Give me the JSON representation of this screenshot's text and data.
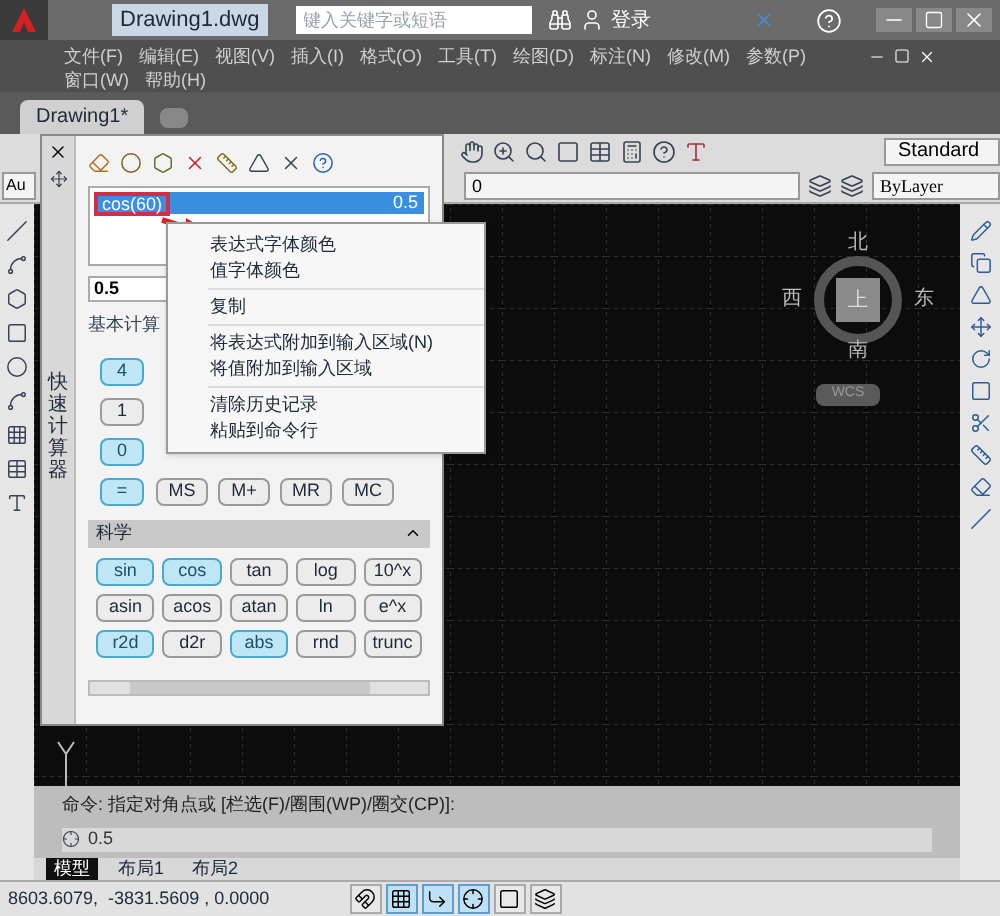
{
  "title_bar": {
    "title": "Drawing1.dwg",
    "search": {
      "placeholder": "键入关键字或短语"
    },
    "login": "登录"
  },
  "menu_rows": [
    [
      "文件(F)",
      "编辑(E)",
      "视图(V)",
      "插入(I)",
      "格式(O)",
      "工具(T)",
      "绘图(D)",
      "标注(N)",
      "修改(M)",
      "参数(P)"
    ],
    [
      "窗口(W)",
      "帮助(H)"
    ]
  ],
  "document_tabs": [
    {
      "label": "Drawing1*",
      "selected": true
    }
  ],
  "toolbar": {
    "left_dropdown": "Au",
    "text_style": "Standard",
    "layer": "0",
    "color_control": "ByLayer"
  },
  "calculator": {
    "title": "快速计算器",
    "history": [
      {
        "expression": "cos(60)",
        "value": "0.5",
        "selected": true
      }
    ],
    "input": "0.5",
    "basic": {
      "title": "基本计算",
      "keys": [
        {
          "label": "4",
          "highlighted": true
        },
        {
          "label": "1",
          "highlighted": false
        },
        {
          "label": "0",
          "highlighted": true
        },
        {
          "label": "=",
          "highlighted": true
        }
      ],
      "memory_keys": [
        {
          "label": "MS",
          "highlighted": false
        },
        {
          "label": "M+",
          "highlighted": false
        },
        {
          "label": "MR",
          "highlighted": false
        },
        {
          "label": "MC",
          "highlighted": false
        }
      ]
    },
    "scientific": {
      "title": "科学",
      "expanded": true,
      "keys": [
        {
          "label": "sin",
          "highlighted": true
        },
        {
          "label": "cos",
          "highlighted": true
        },
        {
          "label": "tan",
          "highlighted": false
        },
        {
          "label": "log",
          "highlighted": false
        },
        {
          "label": "10^x",
          "highlighted": false
        },
        {
          "label": "asin",
          "highlighted": false
        },
        {
          "label": "acos",
          "highlighted": false
        },
        {
          "label": "atan",
          "highlighted": false
        },
        {
          "label": "ln",
          "highlighted": false
        },
        {
          "label": "e^x",
          "highlighted": false
        },
        {
          "label": "r2d",
          "highlighted": true
        },
        {
          "label": "d2r",
          "highlighted": false
        },
        {
          "label": "abs",
          "highlighted": true
        },
        {
          "label": "rnd",
          "highlighted": false
        },
        {
          "label": "trunc",
          "highlighted": false
        }
      ]
    }
  },
  "context_menu": {
    "groups": [
      [
        "表达式字体颜色",
        "值字体颜色"
      ],
      [
        "复制"
      ],
      [
        "将表达式附加到输入区域(N)",
        "将值附加到输入区域"
      ],
      [
        "清除历史记录",
        "粘贴到命令行"
      ]
    ]
  },
  "viewcube": {
    "north": "北",
    "west": "西",
    "east": "东",
    "south": "南",
    "top": "上",
    "wcs": "WCS"
  },
  "command_line": {
    "history": "命令:  指定对角点或 [栏选(F)/圈围(WP)/圈交(CP)]:",
    "input": "0.5"
  },
  "layout_tabs": [
    {
      "label": "模型",
      "selected": true
    },
    {
      "label": "布局1",
      "selected": false
    },
    {
      "label": "布局2",
      "selected": false
    }
  ],
  "status_bar": {
    "coordinates": "8603.6079,  -3831.5609 , 0.0000",
    "toggles": [
      {
        "kind": "snap",
        "on": false
      },
      {
        "kind": "grid",
        "on": true
      },
      {
        "kind": "ortho",
        "on": true
      },
      {
        "kind": "polar",
        "on": true
      },
      {
        "kind": "osnap",
        "on": false
      },
      {
        "kind": "track",
        "on": false
      }
    ]
  }
}
